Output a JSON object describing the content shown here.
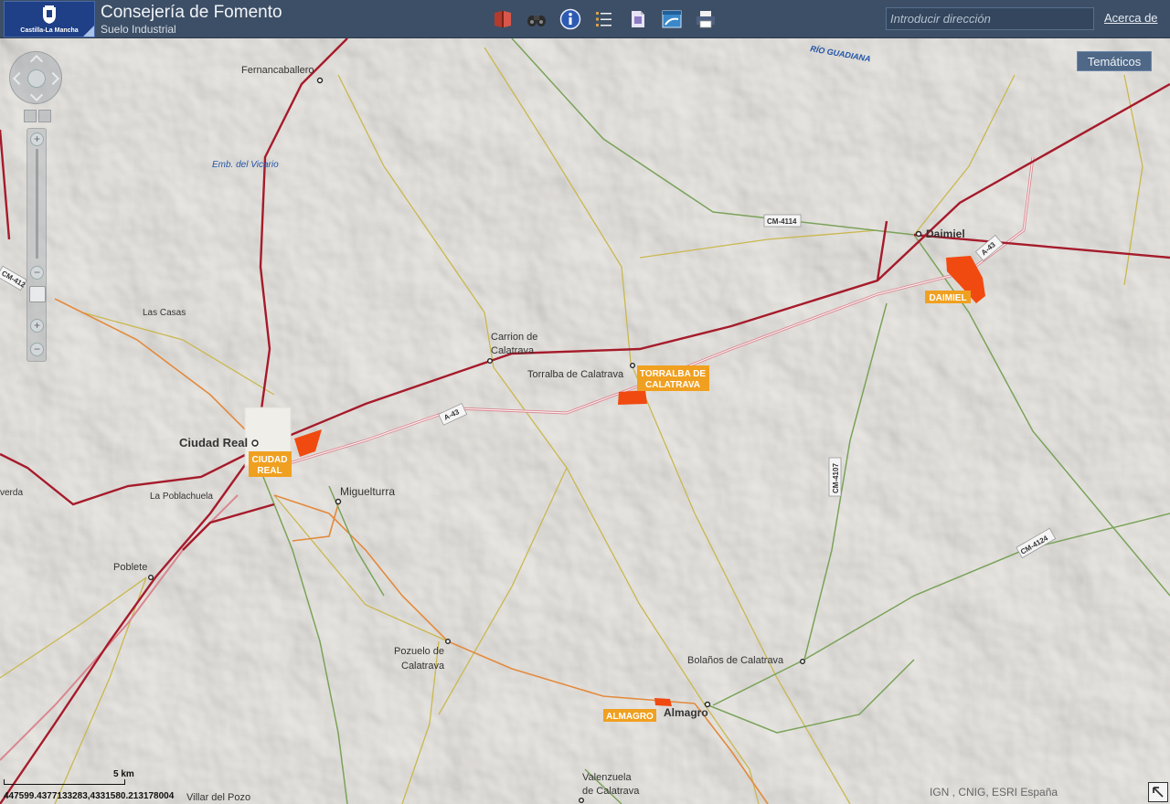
{
  "header": {
    "logo_text": "Castilla-La Mancha",
    "title": "Consejería de Fomento",
    "subtitle": "Suelo Industrial",
    "address_placeholder": "Introducir dirección",
    "about_label": "Acerca de",
    "tools": [
      {
        "name": "book-icon",
        "color": "#b33a2e"
      },
      {
        "name": "binoculars-icon",
        "color": "#2b2b2b"
      },
      {
        "name": "info-icon",
        "color": "#2d5bb3"
      },
      {
        "name": "list-icon",
        "color": "#d6a24a"
      },
      {
        "name": "document-icon",
        "color": "#8c7bc2"
      },
      {
        "name": "map-window-icon",
        "color": "#3a88c9"
      },
      {
        "name": "printer-icon",
        "color": "#4f6180"
      }
    ]
  },
  "map": {
    "tematicos_label": "Temáticos",
    "scale_label": "5 km",
    "coordinates": "447599.4377133283,4331580.213178004",
    "attribution": "IGN , CNIG, ESRI España",
    "place_labels": [
      "Fernancaballero",
      "Emb. del Vicario",
      "RÍO GUADIANA",
      "Daimiel",
      "Las Casas",
      "Carrion de",
      "Calatrava",
      "Torralba de Calatrava",
      "Ciudad Real",
      "Miguelturra",
      "La Poblachuela",
      "Poblete",
      "Pozuelo de",
      "Calatrava",
      "Bolaños de Calatrava",
      "Almagro",
      "Valenzuela",
      "de Calatrava",
      "Villar del Pozo",
      "verda"
    ],
    "road_labels": [
      "CM-4114",
      "A-43",
      "A-43",
      "CM-4107",
      "CM-4124",
      "CM-412"
    ],
    "industrial_labels": [
      {
        "lines": [
          "DAIMIEL"
        ]
      },
      {
        "lines": [
          "TORRALBA DE",
          "CALATRAVA"
        ]
      },
      {
        "lines": [
          "CIUDAD",
          "REAL"
        ]
      },
      {
        "lines": [
          "ALMAGRO"
        ]
      }
    ],
    "colors": {
      "background": "#e9e6e1",
      "rail": "#a61b2b",
      "green_road": "#7aa35a",
      "yellow_road": "#c9b84f",
      "orange_road": "#e38a3c",
      "industrial": "#f04a10",
      "industrial_label": "#f0a020"
    }
  }
}
